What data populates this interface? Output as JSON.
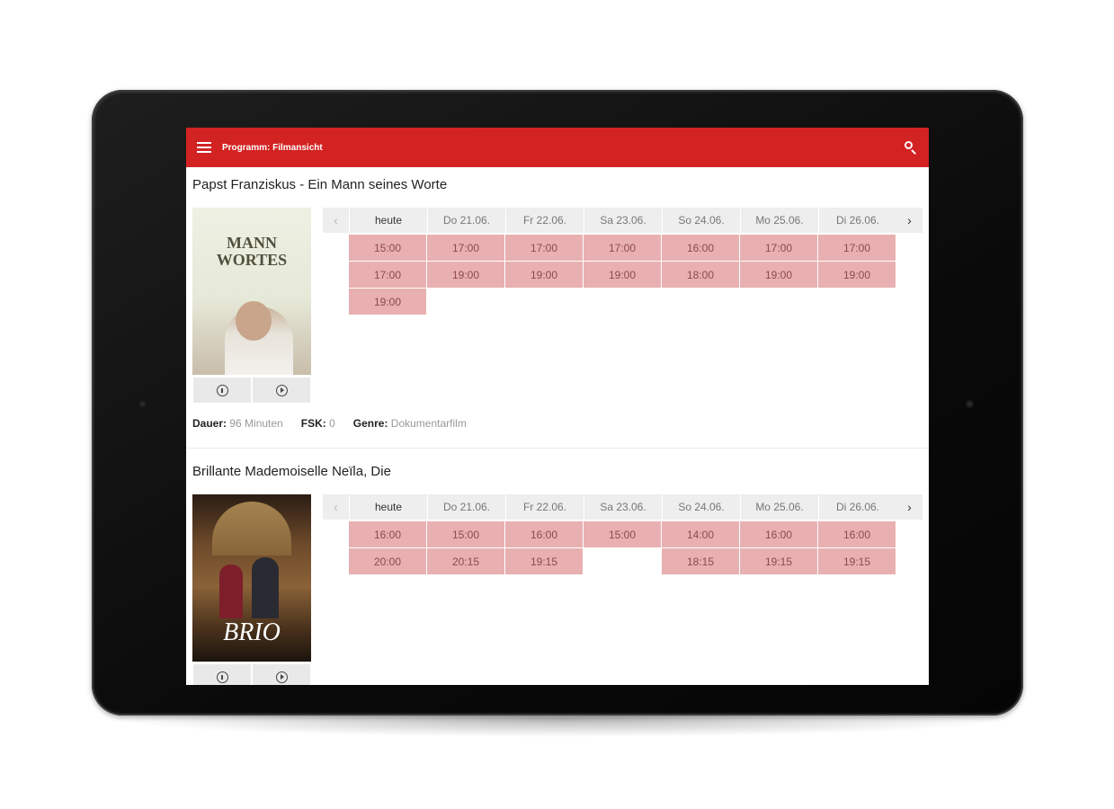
{
  "appbar": {
    "title": "Programm: Filmansicht",
    "menu_icon": "menu-icon",
    "search_icon": "search-icon",
    "accent_color": "#d32222"
  },
  "movies": [
    {
      "title": "Papst Franziskus - Ein Mann seines Worte",
      "poster_text": "MANN WORTES",
      "days": [
        "heute",
        "Do 21.06.",
        "Fr 22.06.",
        "Sa 23.06.",
        "So 24.06.",
        "Mo 25.06.",
        "Di 26.06."
      ],
      "times": [
        [
          "15:00",
          "17:00",
          "19:00"
        ],
        [
          "17:00",
          "19:00"
        ],
        [
          "17:00",
          "19:00"
        ],
        [
          "17:00",
          "19:00"
        ],
        [
          "16:00",
          "18:00"
        ],
        [
          "17:00",
          "19:00"
        ],
        [
          "17:00",
          "19:00"
        ]
      ],
      "meta": {
        "duration_label": "Dauer:",
        "duration_value": "96 Minuten",
        "fsk_label": "FSK:",
        "fsk_value": "0",
        "genre_label": "Genre:",
        "genre_value": "Dokumentarfilm"
      }
    },
    {
      "title": "Brillante Mademoiselle Neïla, Die",
      "poster_text": "BRIO",
      "days": [
        "heute",
        "Do 21.06.",
        "Fr 22.06.",
        "Sa 23.06.",
        "So 24.06.",
        "Mo 25.06.",
        "Di 26.06."
      ],
      "times": [
        [
          "16:00",
          "20:00"
        ],
        [
          "15:00",
          "20:15"
        ],
        [
          "16:00",
          "19:15"
        ],
        [
          "15:00"
        ],
        [
          "14:00",
          "18:15"
        ],
        [
          "16:00",
          "19:15"
        ],
        [
          "16:00",
          "19:15"
        ]
      ]
    }
  ]
}
